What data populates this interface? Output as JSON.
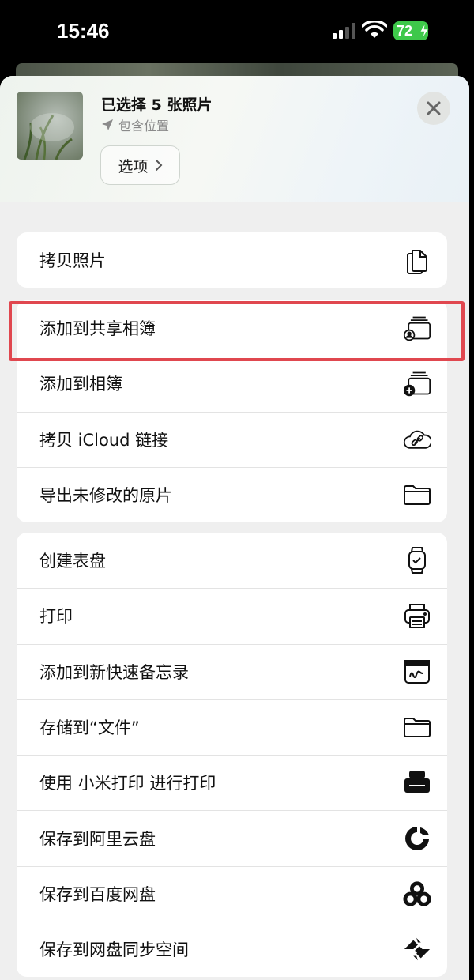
{
  "status_bar": {
    "time": "15:46",
    "battery": "72"
  },
  "header": {
    "title": "已选择 5 张照片",
    "location_label": "包含位置",
    "options_label": "选项"
  },
  "group1": [
    {
      "label": "拷贝照片",
      "icon": "copy-icon"
    }
  ],
  "group2": [
    {
      "label": "添加到共享相簿",
      "icon": "shared-album-icon"
    },
    {
      "label": "添加到相簿",
      "icon": "add-album-icon"
    },
    {
      "label": "拷贝 iCloud 链接",
      "icon": "icloud-link-icon"
    },
    {
      "label": "导出未修改的原片",
      "icon": "folder-icon"
    }
  ],
  "group3": [
    {
      "label": "创建表盘",
      "icon": "watch-icon"
    },
    {
      "label": "打印",
      "icon": "printer-icon"
    },
    {
      "label": "添加到新快速备忘录",
      "icon": "quick-note-icon"
    },
    {
      "label": "存储到“文件”",
      "icon": "folder-icon"
    },
    {
      "label": "使用 小米打印 进行打印",
      "icon": "xiaomi-print-icon"
    },
    {
      "label": "保存到阿里云盘",
      "icon": "aliyun-drive-icon"
    },
    {
      "label": "保存到百度网盘",
      "icon": "baidu-netdisk-icon"
    },
    {
      "label": "保存到网盘同步空间",
      "icon": "sync-space-icon"
    }
  ],
  "colors": {
    "highlight": "#e0474f",
    "battery": "#3ec84a"
  }
}
